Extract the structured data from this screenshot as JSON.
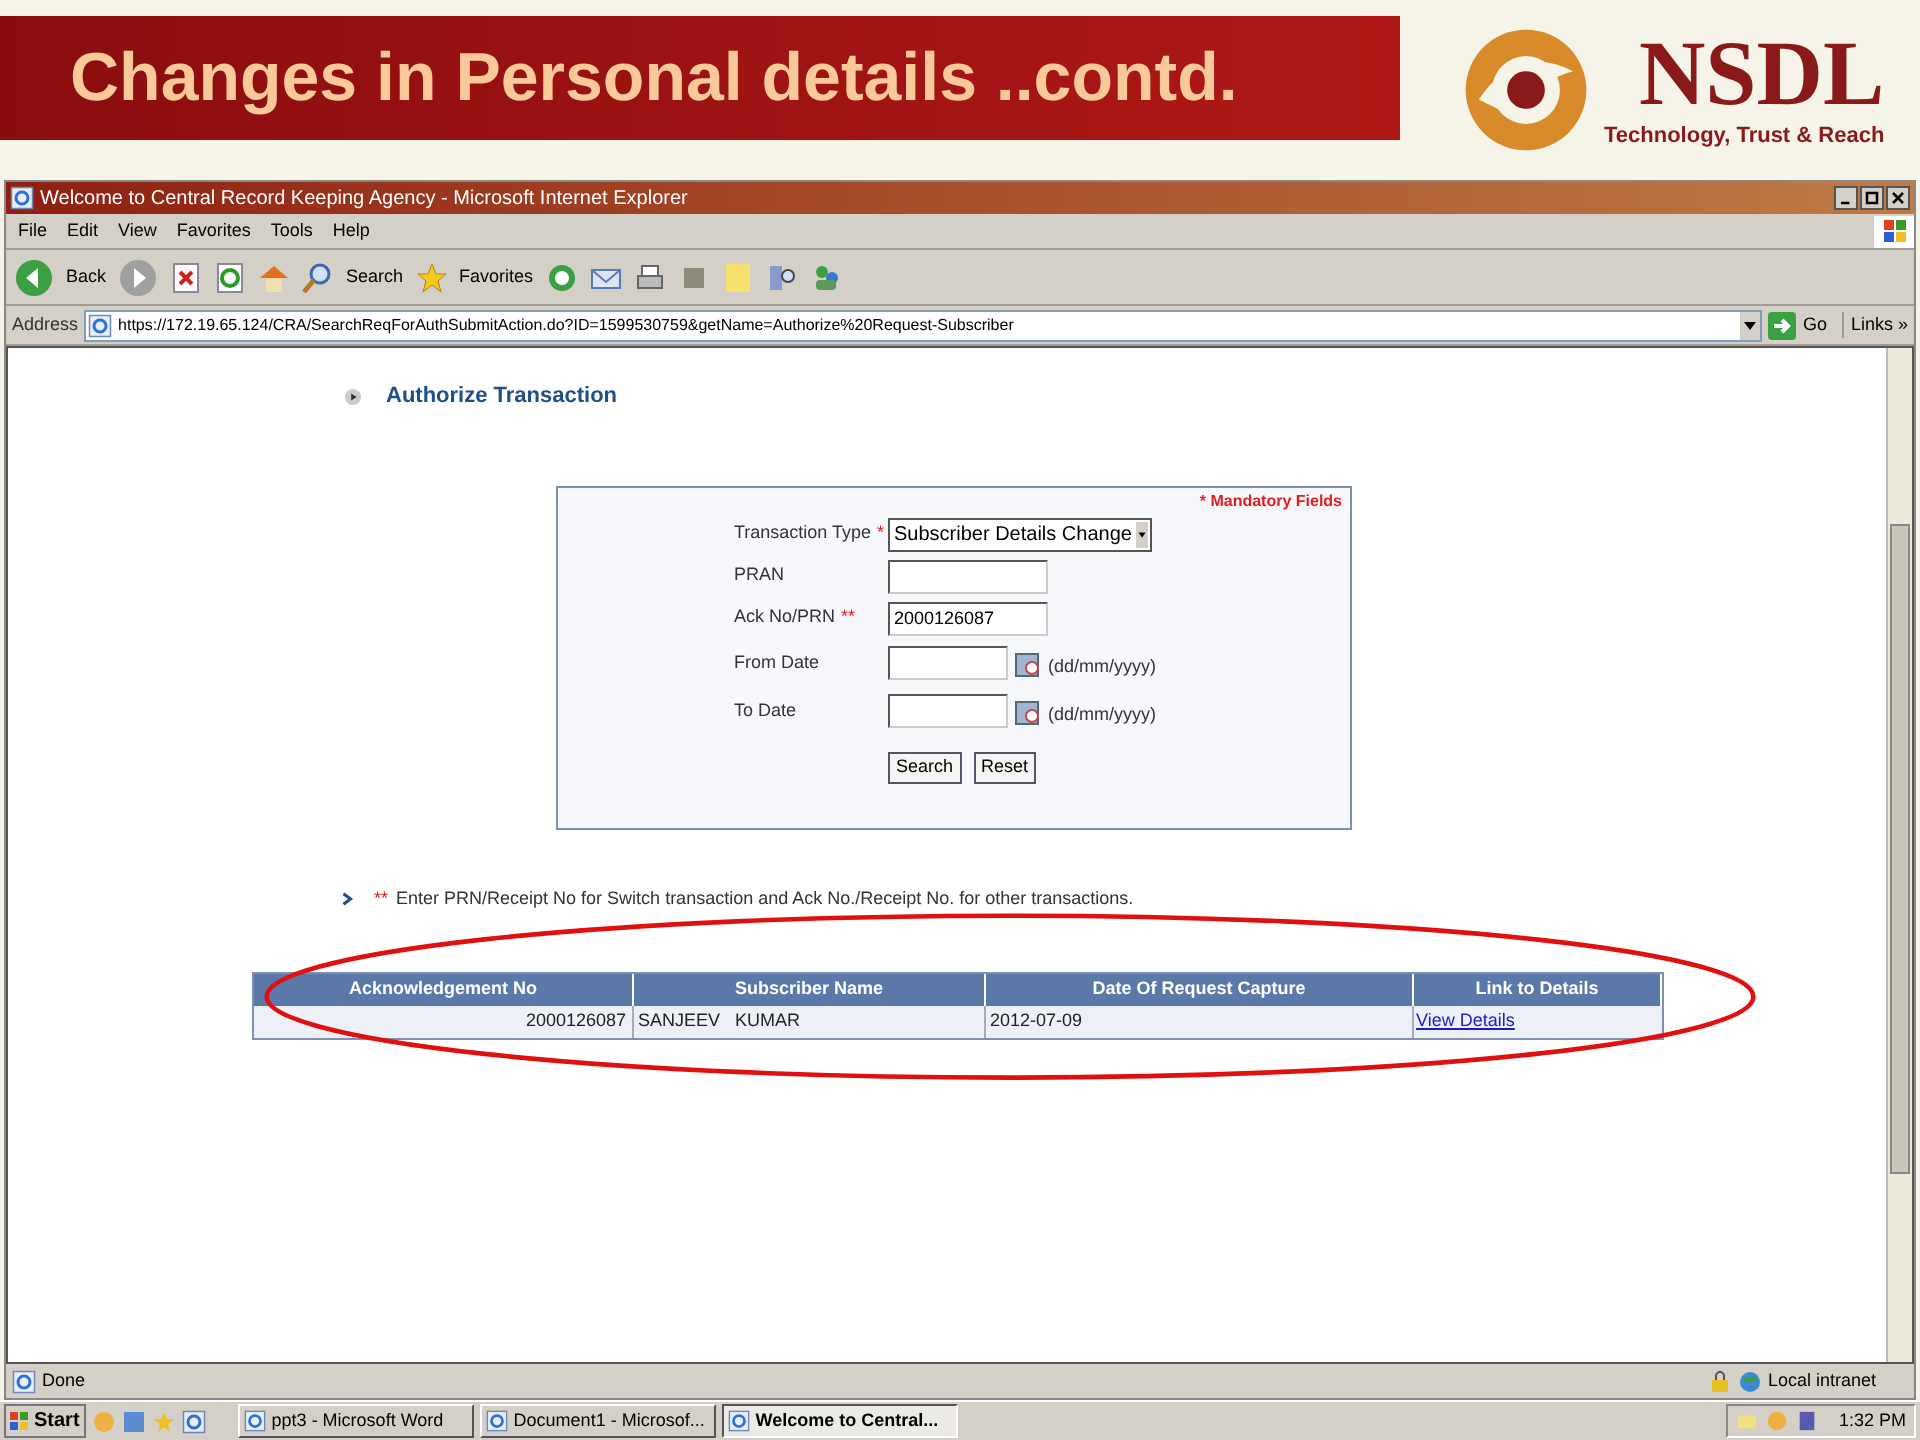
{
  "slide": {
    "title": "Changes in Personal details ..contd.",
    "logo": {
      "name": "NSDL",
      "tagline": "Technology, Trust & Reach"
    }
  },
  "window": {
    "title": "Welcome to Central Record Keeping Agency - Microsoft Internet Explorer"
  },
  "menu": [
    "File",
    "Edit",
    "View",
    "Favorites",
    "Tools",
    "Help"
  ],
  "toolbar": {
    "back": "Back",
    "search": "Search",
    "favorites": "Favorites"
  },
  "address": {
    "label": "Address",
    "url": "https://172.19.65.124/CRA/SearchReqForAuthSubmitAction.do?ID=1599530759&getName=Authorize%20Request-Subscriber",
    "go": "Go",
    "links": "Links »"
  },
  "page": {
    "heading": "Authorize Transaction",
    "mandatory": "* Mandatory Fields",
    "fields": [
      {
        "kind": "select",
        "label": "Transaction Type",
        "marker": "*",
        "value": "Subscriber Details Change"
      },
      {
        "kind": "text",
        "label": "PRAN"
      },
      {
        "kind": "text",
        "label": "Ack No/PRN",
        "marker": "**",
        "value": "2000126087"
      },
      {
        "kind": "date",
        "label": "From Date",
        "hint": "(dd/mm/yyyy)"
      },
      {
        "kind": "date",
        "label": "To Date",
        "hint": "(dd/mm/yyyy)"
      }
    ],
    "buttons": [
      "Search",
      "Reset"
    ],
    "note": {
      "marker": "**",
      "text": "Enter PRN/Receipt No for Switch transaction and Ack No./Receipt No. for other transactions."
    },
    "table": {
      "columns": [
        "Acknowledgement No",
        "Subscriber Name",
        "Date Of Request Capture",
        "Link to Details"
      ],
      "rows": [
        {
          "ack": "2000126087",
          "name": "SANJEEV   KUMAR",
          "date": "2012-07-09",
          "link": "View Details"
        }
      ]
    }
  },
  "status_bar": {
    "text": "Done",
    "zone": "Local intranet"
  },
  "taskbar": {
    "start": "Start",
    "tasks": [
      {
        "label": "ppt3 - Microsoft Word",
        "selected": false
      },
      {
        "label": "Document1 - Microsof...",
        "selected": false
      },
      {
        "label": "Welcome to Central...",
        "selected": true
      }
    ],
    "clock": "1:32 PM"
  }
}
